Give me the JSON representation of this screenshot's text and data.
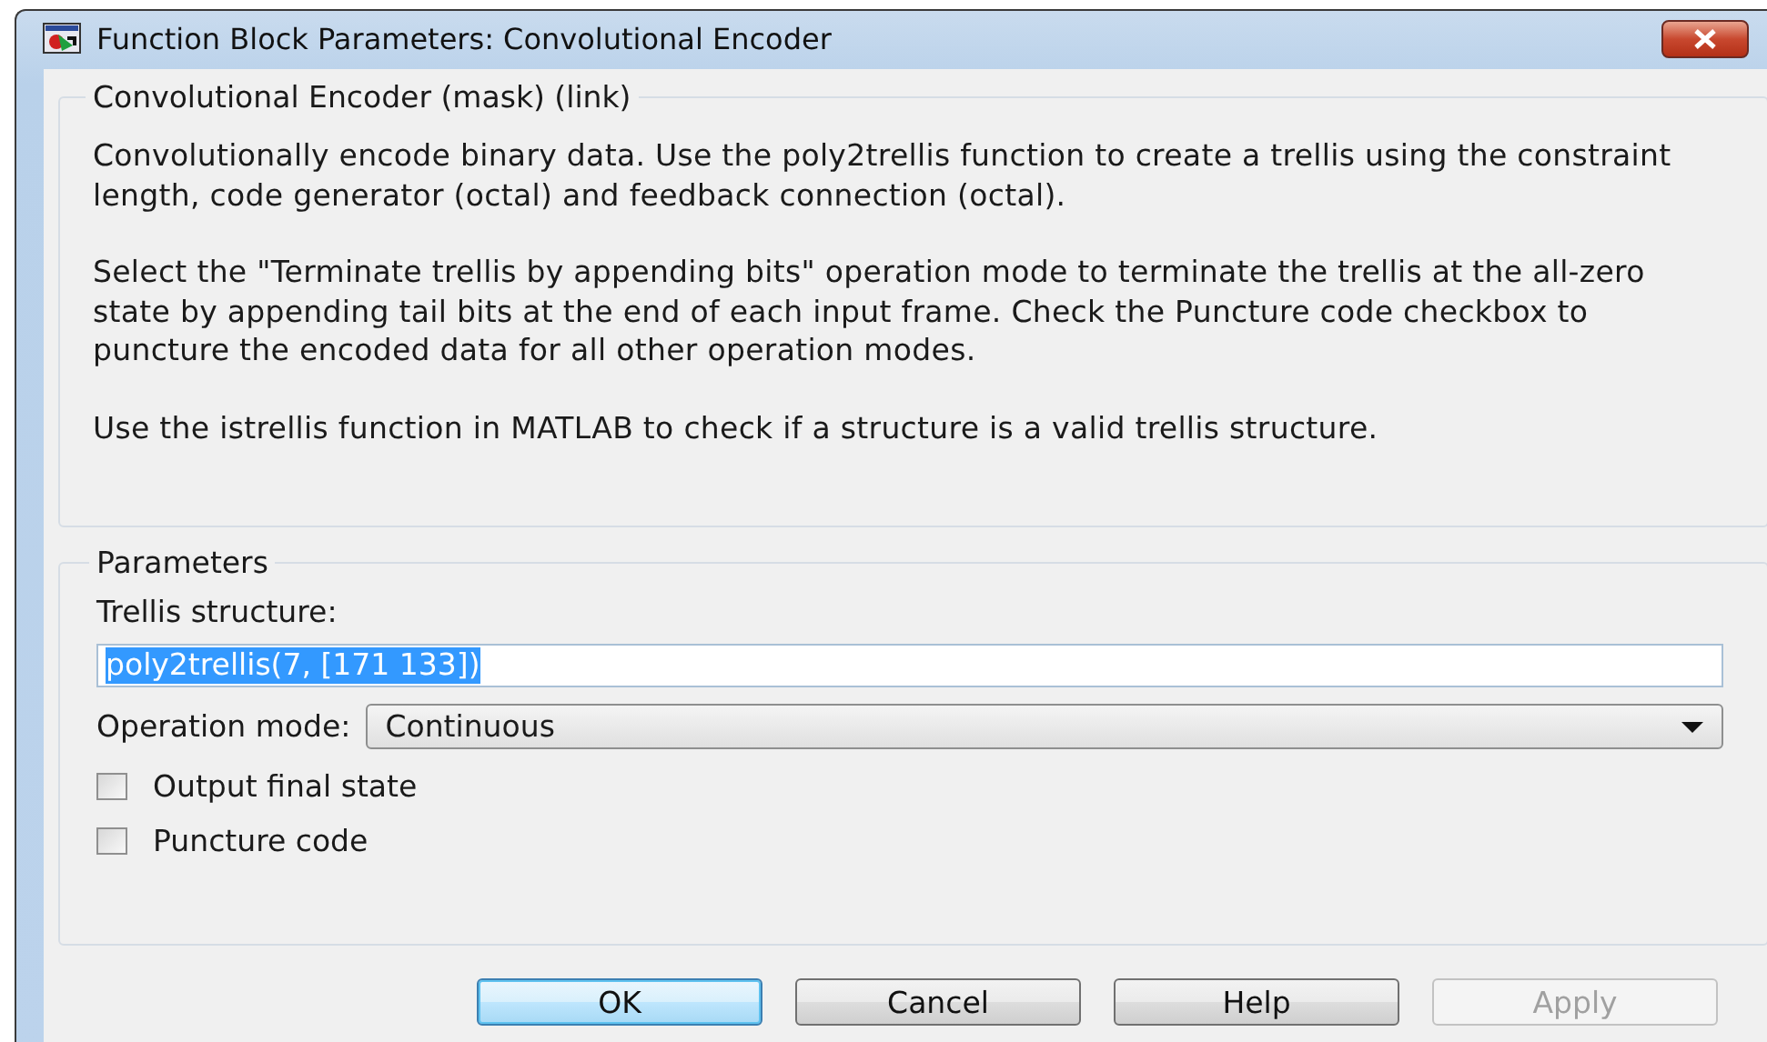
{
  "window": {
    "title": "Function Block Parameters: Convolutional Encoder"
  },
  "description": {
    "title": "Convolutional Encoder (mask) (link)",
    "paragraphs": [
      "Convolutionally encode binary data.  Use the poly2trellis function to create a trellis using the constraint length, code generator (octal) and feedback connection (octal).",
      "Select the \"Terminate trellis by appending bits\" operation mode to terminate the trellis at the all-zero state by appending tail bits at the end of each input frame.  Check the Puncture code checkbox to puncture the encoded data for all other operation modes.",
      "Use the istrellis function in MATLAB to check if a structure is a valid trellis structure."
    ]
  },
  "parameters": {
    "title": "Parameters",
    "trellis_structure": {
      "label": "Trellis structure:",
      "value": "poly2trellis(7, [171 133])",
      "selected": true
    },
    "operation_mode": {
      "label": "Operation mode:",
      "value": "Continuous"
    },
    "checkboxes": [
      {
        "label": "Output final state",
        "checked": false
      },
      {
        "label": "Puncture code",
        "checked": false
      }
    ]
  },
  "buttons": [
    {
      "label": "OK",
      "default": true,
      "disabled": false
    },
    {
      "label": "Cancel",
      "default": false,
      "disabled": false
    },
    {
      "label": "Help",
      "default": false,
      "disabled": false
    },
    {
      "label": "Apply",
      "default": false,
      "disabled": true
    }
  ]
}
